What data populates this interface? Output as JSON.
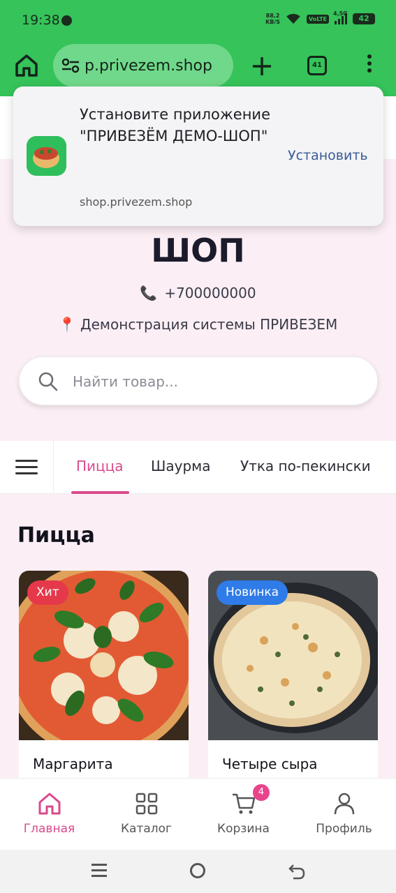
{
  "status_bar": {
    "time": "19:38",
    "net_speed_value": "88,2",
    "net_speed_unit": "KB/S",
    "volte": "VoLTE",
    "network": "4,5G",
    "battery": "42"
  },
  "browser": {
    "url": "p.privezem.shop",
    "tab_count": "41"
  },
  "install_banner": {
    "text": "Установите приложение \"ПРИВЕЗЁМ ДЕМО-ШОП\"",
    "host": "shop.privezem.shop",
    "install_label": "Установить"
  },
  "hero": {
    "title_line2": "ШОП",
    "phone": "+700000000",
    "address": "Демонстрация системы ПРИВЕЗЕМ"
  },
  "search": {
    "placeholder": "Найти товар..."
  },
  "categories": {
    "tabs": [
      {
        "label": "Пицца",
        "active": true
      },
      {
        "label": "Шаурма",
        "active": false
      },
      {
        "label": "Утка по-пекински",
        "active": false
      }
    ]
  },
  "section": {
    "title": "Пицца",
    "products": [
      {
        "name": "Маргарита",
        "badge": "Хит",
        "badge_color": "#e5394b"
      },
      {
        "name": "Четыре сыра",
        "badge": "Новинка",
        "badge_color": "#2f7be8"
      }
    ]
  },
  "bottom_nav": {
    "items": [
      {
        "label": "Главная",
        "icon": "home-icon",
        "active": true
      },
      {
        "label": "Каталог",
        "icon": "grid-icon",
        "active": false
      },
      {
        "label": "Корзина",
        "icon": "cart-icon",
        "active": false
      },
      {
        "label": "Профиль",
        "icon": "user-icon",
        "active": false
      }
    ],
    "cart_count": "4"
  },
  "colors": {
    "browser_chrome": "#35c35a",
    "accent": "#d94a8c",
    "badge_hit": "#e5394b",
    "badge_new": "#2f7be8"
  }
}
